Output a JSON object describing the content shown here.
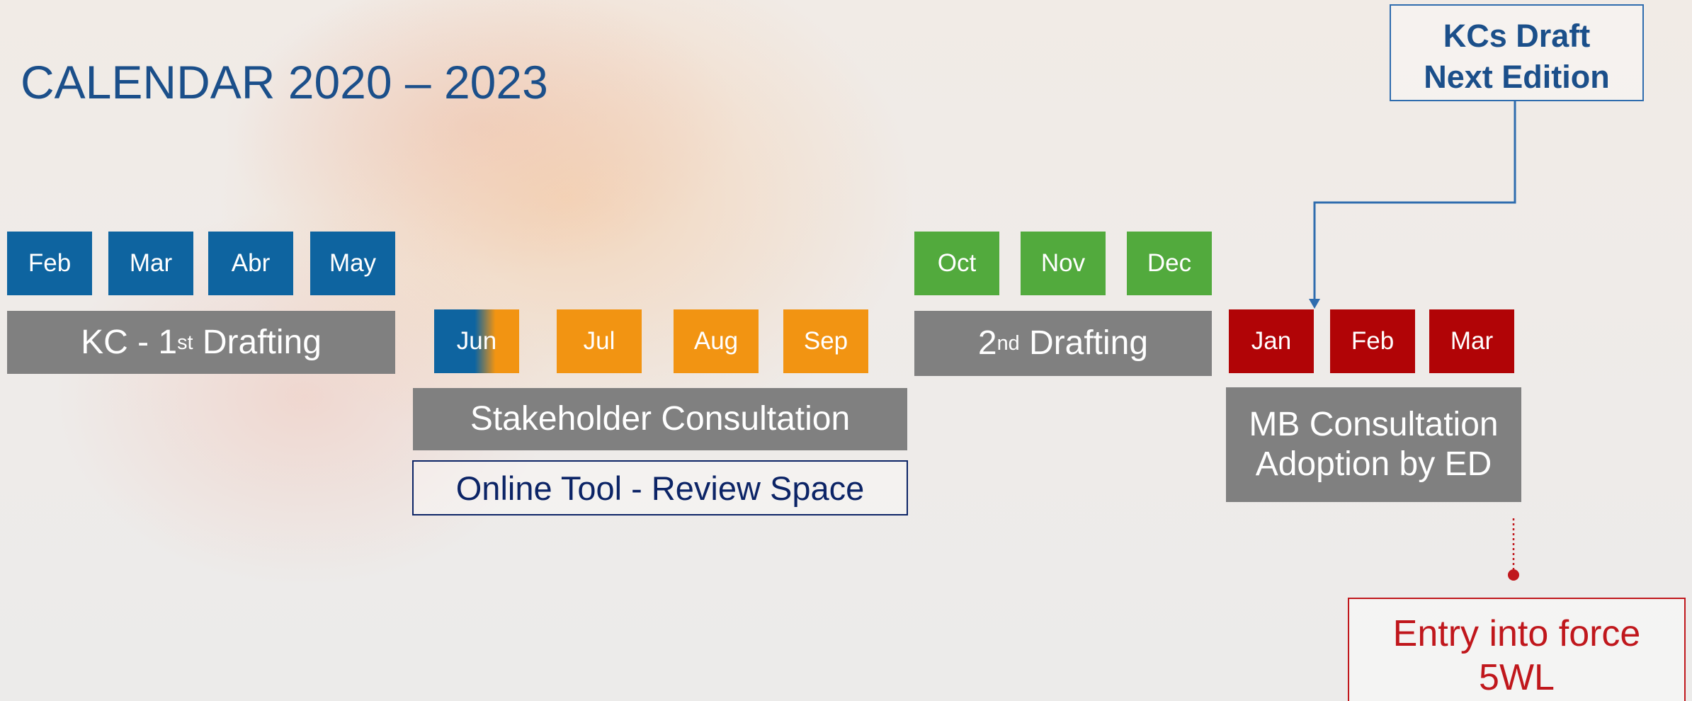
{
  "title": "CALENDAR 2020 – 2023",
  "callout": {
    "line1": "KCs Draft",
    "line2": "Next Edition"
  },
  "row1_months": [
    "Feb",
    "Mar",
    "Abr",
    "May"
  ],
  "row2_months": [
    "Jun",
    "Jul",
    "Aug",
    "Sep"
  ],
  "row3_months": [
    "Oct",
    "Nov",
    "Dec"
  ],
  "row4_months": [
    "Jan",
    "Feb",
    "Mar"
  ],
  "bars": {
    "first_drafting_prefix": "KC - 1",
    "first_drafting_sup": "st",
    "first_drafting_suffix": " Drafting",
    "second_drafting_prefix": "2",
    "second_drafting_sup": "nd",
    "second_drafting_suffix": " Drafting",
    "stakeholder": "Stakeholder Consultation",
    "online_tool": "Online Tool - Review Space",
    "mb_line1": "MB Consultation",
    "mb_line2": "Adoption by ED"
  },
  "entry": {
    "line1": "Entry into force",
    "line2": "5WL"
  },
  "colors": {
    "blue": "#0e64a0",
    "green": "#52aa3d",
    "orange": "#f29412",
    "red": "#b10406",
    "gray": "#808080",
    "title": "#1b4f8a"
  }
}
